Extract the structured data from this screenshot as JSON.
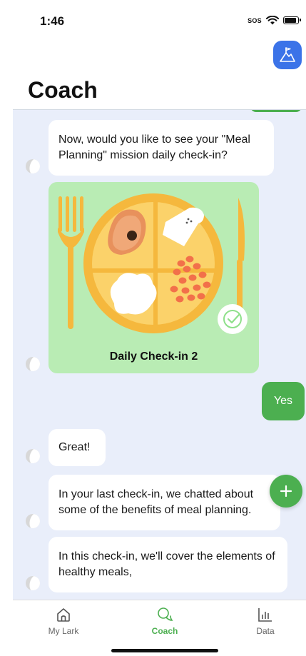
{
  "status_bar": {
    "time": "1:46",
    "sos": "SOS"
  },
  "header": {
    "title": "Coach",
    "mission_icon": "mountain-flag-icon",
    "mission_color": "#3b73e8"
  },
  "colors": {
    "accent": "#4caf50",
    "chat_background": "#e9eefa",
    "card_background": "#b9ecb4"
  },
  "messages": [
    {
      "from": "user",
      "text": ""
    },
    {
      "from": "coach",
      "text": "Now, would you like to see your \"Meal Planning\" mission daily check-in?"
    },
    {
      "from": "coach",
      "type": "card",
      "caption": "Daily Check-in 2",
      "icon": "meal-plate-illustration",
      "status_icon": "check-circle-icon"
    },
    {
      "from": "user",
      "text": "Yes"
    },
    {
      "from": "coach",
      "text": "Great!"
    },
    {
      "from": "coach",
      "text": "In your last check-in, we chatted about some of the benefits of meal planning."
    },
    {
      "from": "coach",
      "text": "In this check-in, we'll cover the elements of healthy meals,"
    }
  ],
  "fab": {
    "icon": "plus-icon"
  },
  "tabs": [
    {
      "label": "My Lark",
      "icon": "home-icon",
      "active": false
    },
    {
      "label": "Coach",
      "icon": "chat-bubble-icon",
      "active": true
    },
    {
      "label": "Data",
      "icon": "bar-chart-icon",
      "active": false
    }
  ]
}
